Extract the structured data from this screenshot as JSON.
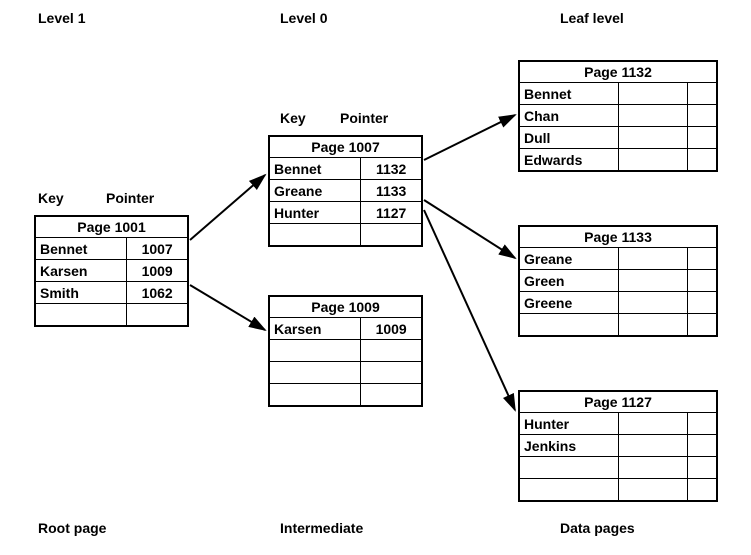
{
  "headers": {
    "level1": "Level 1",
    "level0": "Level 0",
    "leaf": "Leaf level",
    "key": "Key",
    "pointer": "Pointer"
  },
  "footers": {
    "root": "Root page",
    "intermediate": "Intermediate",
    "data": "Data pages"
  },
  "pages": {
    "p1001": {
      "title": "Page 1001",
      "rows": [
        {
          "key": "Bennet",
          "ptr": "1007"
        },
        {
          "key": "Karsen",
          "ptr": "1009"
        },
        {
          "key": "Smith",
          "ptr": "1062"
        }
      ]
    },
    "p1007": {
      "title": "Page 1007",
      "rows": [
        {
          "key": "Bennet",
          "ptr": "1132"
        },
        {
          "key": "Greane",
          "ptr": "1133"
        },
        {
          "key": "Hunter",
          "ptr": "1127"
        }
      ]
    },
    "p1009": {
      "title": "Page 1009",
      "rows": [
        {
          "key": "Karsen",
          "ptr": "1009"
        }
      ]
    },
    "p1132": {
      "title": "Page 1132",
      "rows": [
        "Bennet",
        "Chan",
        "Dull",
        "Edwards"
      ]
    },
    "p1133": {
      "title": "Page 1133",
      "rows": [
        "Greane",
        "Green",
        "Greene"
      ]
    },
    "p1127": {
      "title": "Page 1127",
      "rows": [
        "Hunter",
        "Jenkins"
      ]
    }
  }
}
